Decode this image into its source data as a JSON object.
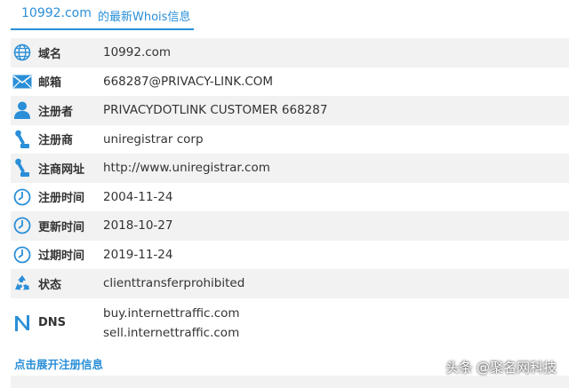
{
  "tab": {
    "domain": "10992.com",
    "suffix": "的最新Whois信息"
  },
  "colors": {
    "accent": "#2a8fd8",
    "row_alt": "#f2f2f2"
  },
  "rows": [
    {
      "icon": "globe-icon",
      "label": "域名",
      "value": "10992.com"
    },
    {
      "icon": "envelope-icon",
      "label": "邮箱",
      "value": "668287@PRIVACY-LINK.COM"
    },
    {
      "icon": "person-icon",
      "label": "注册者",
      "value": "PRIVACYDOTLINK CUSTOMER 668287"
    },
    {
      "icon": "stamp-icon",
      "label": "注册商",
      "value": "uniregistrar corp"
    },
    {
      "icon": "stamp-icon",
      "label": "注商网址",
      "value": "http://www.uniregistrar.com"
    },
    {
      "icon": "clock-icon",
      "label": "注册时间",
      "value": "2004-11-24"
    },
    {
      "icon": "clock-icon",
      "label": "更新时间",
      "value": "2018-10-27"
    },
    {
      "icon": "clock-icon",
      "label": "过期时间",
      "value": "2019-11-24"
    },
    {
      "icon": "recycle-icon",
      "label": "状态",
      "value": "clienttransferprohibited"
    }
  ],
  "dns": {
    "icon": "dns-icon",
    "label": "DNS",
    "servers": [
      "buy.internettraffic.com",
      "sell.internettraffic.com"
    ]
  },
  "expand_link": "点击展开注册信息",
  "watermark": "头条 @聚名网科技"
}
